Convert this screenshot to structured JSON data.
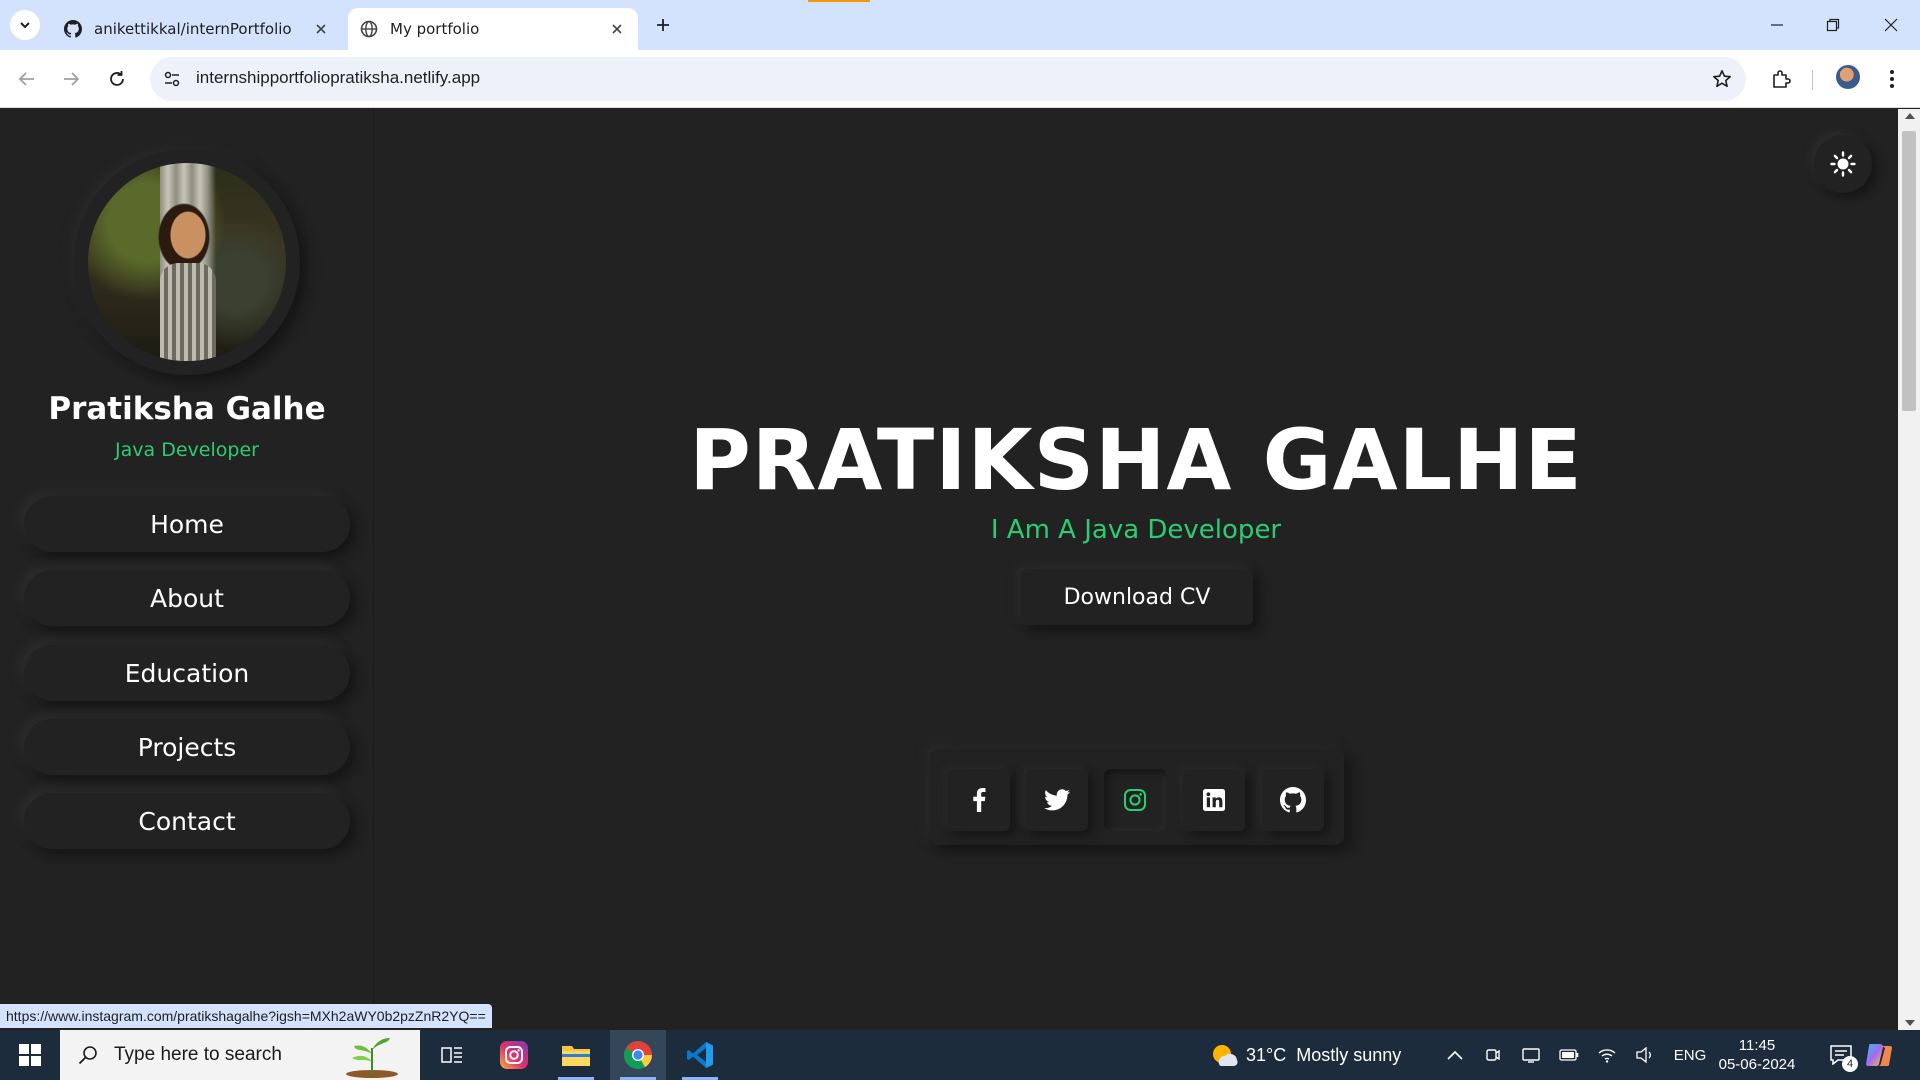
{
  "browser": {
    "tabs": [
      {
        "title": "anikettikkal/internPortfolio",
        "icon": "github-icon"
      },
      {
        "title": "My portfolio",
        "icon": "globe-icon",
        "active": true
      }
    ],
    "url": "internshipportfoliopratiksha.netlify.app",
    "status_url": "https://www.instagram.com/pratikshagalhe?igsh=MXh2aWY0b2pzZnR2YQ=="
  },
  "sidebar": {
    "name": "Pratiksha Galhe",
    "role": "Java Developer",
    "nav": [
      {
        "label": "Home"
      },
      {
        "label": "About"
      },
      {
        "label": "Education"
      },
      {
        "label": "Projects"
      },
      {
        "label": "Contact"
      }
    ]
  },
  "hero": {
    "title": "PRATIKSHA GALHE",
    "subtitle": "I Am A Java Developer",
    "cta_label": "Download CV"
  },
  "social": [
    {
      "name": "facebook-icon"
    },
    {
      "name": "twitter-icon"
    },
    {
      "name": "instagram-icon",
      "active": true
    },
    {
      "name": "linkedin-icon"
    },
    {
      "name": "github-icon"
    }
  ],
  "colors": {
    "accent": "#2ecc71",
    "background": "#222222",
    "text": "#ffffff",
    "chrome_tabbar": "#d3e3fd",
    "taskbar": "#1c2c3c"
  },
  "taskbar": {
    "search_placeholder": "Type here to search",
    "weather_temp": "31°C",
    "weather_text": "Mostly sunny",
    "language": "ENG",
    "time": "11:45",
    "date": "05-06-2024",
    "notification_count": "4"
  }
}
